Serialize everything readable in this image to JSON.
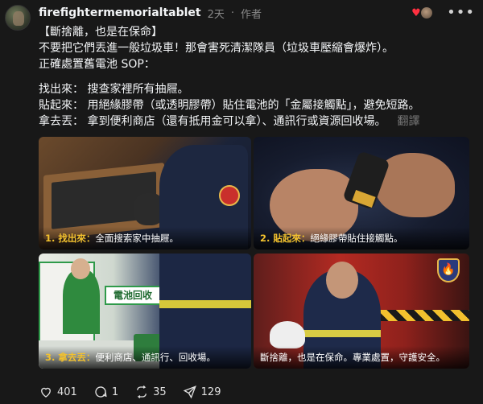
{
  "post": {
    "username": "firefightermemorialtablet",
    "time": "2天",
    "author_tag": "作者",
    "more_label": "•••",
    "lines": [
      "【斷捨離，也是在保命】",
      "不要把它們丟進一般垃圾車！那會害死清潔隊員（垃圾車壓縮會爆炸）。",
      "正確處置舊電池 SOP："
    ],
    "sop": [
      "找出來： 搜查家裡所有抽屜。",
      "貼起來： 用絕緣膠帶（或透明膠帶）貼住電池的「金屬接觸點」，避免短路。",
      "拿去丟： 拿到便利商店（還有抵用金可以拿）、通訊行或資源回收場。"
    ],
    "translate_label": "翻譯"
  },
  "gallery": {
    "p1": {
      "highlight": "1. 找出來：",
      "text": "全面搜索家中抽屜。"
    },
    "p2": {
      "highlight": "2. 貼起來：",
      "text": "絕緣膠帶貼住接觸點。"
    },
    "p3": {
      "highlight": "3. 拿去丟：",
      "text": "便利商店、通訊行、回收場。"
    },
    "p4": {
      "highlight": "",
      "text": "斷捨離，也是在保命。專業處置，守護安全。"
    },
    "store_sign": "電池回收"
  },
  "actions": {
    "likes": "401",
    "comments": "1",
    "reposts": "35",
    "shares": "129"
  },
  "colors": {
    "background": "#181818",
    "text": "#f3f5f7",
    "muted": "#8a8a8a",
    "like_red": "#ff3040",
    "caption_yellow": "#f2c12e"
  },
  "icons": [
    "heart-icon",
    "comment-icon",
    "repost-icon",
    "share-icon",
    "more-icon",
    "fire-shield-icon"
  ]
}
